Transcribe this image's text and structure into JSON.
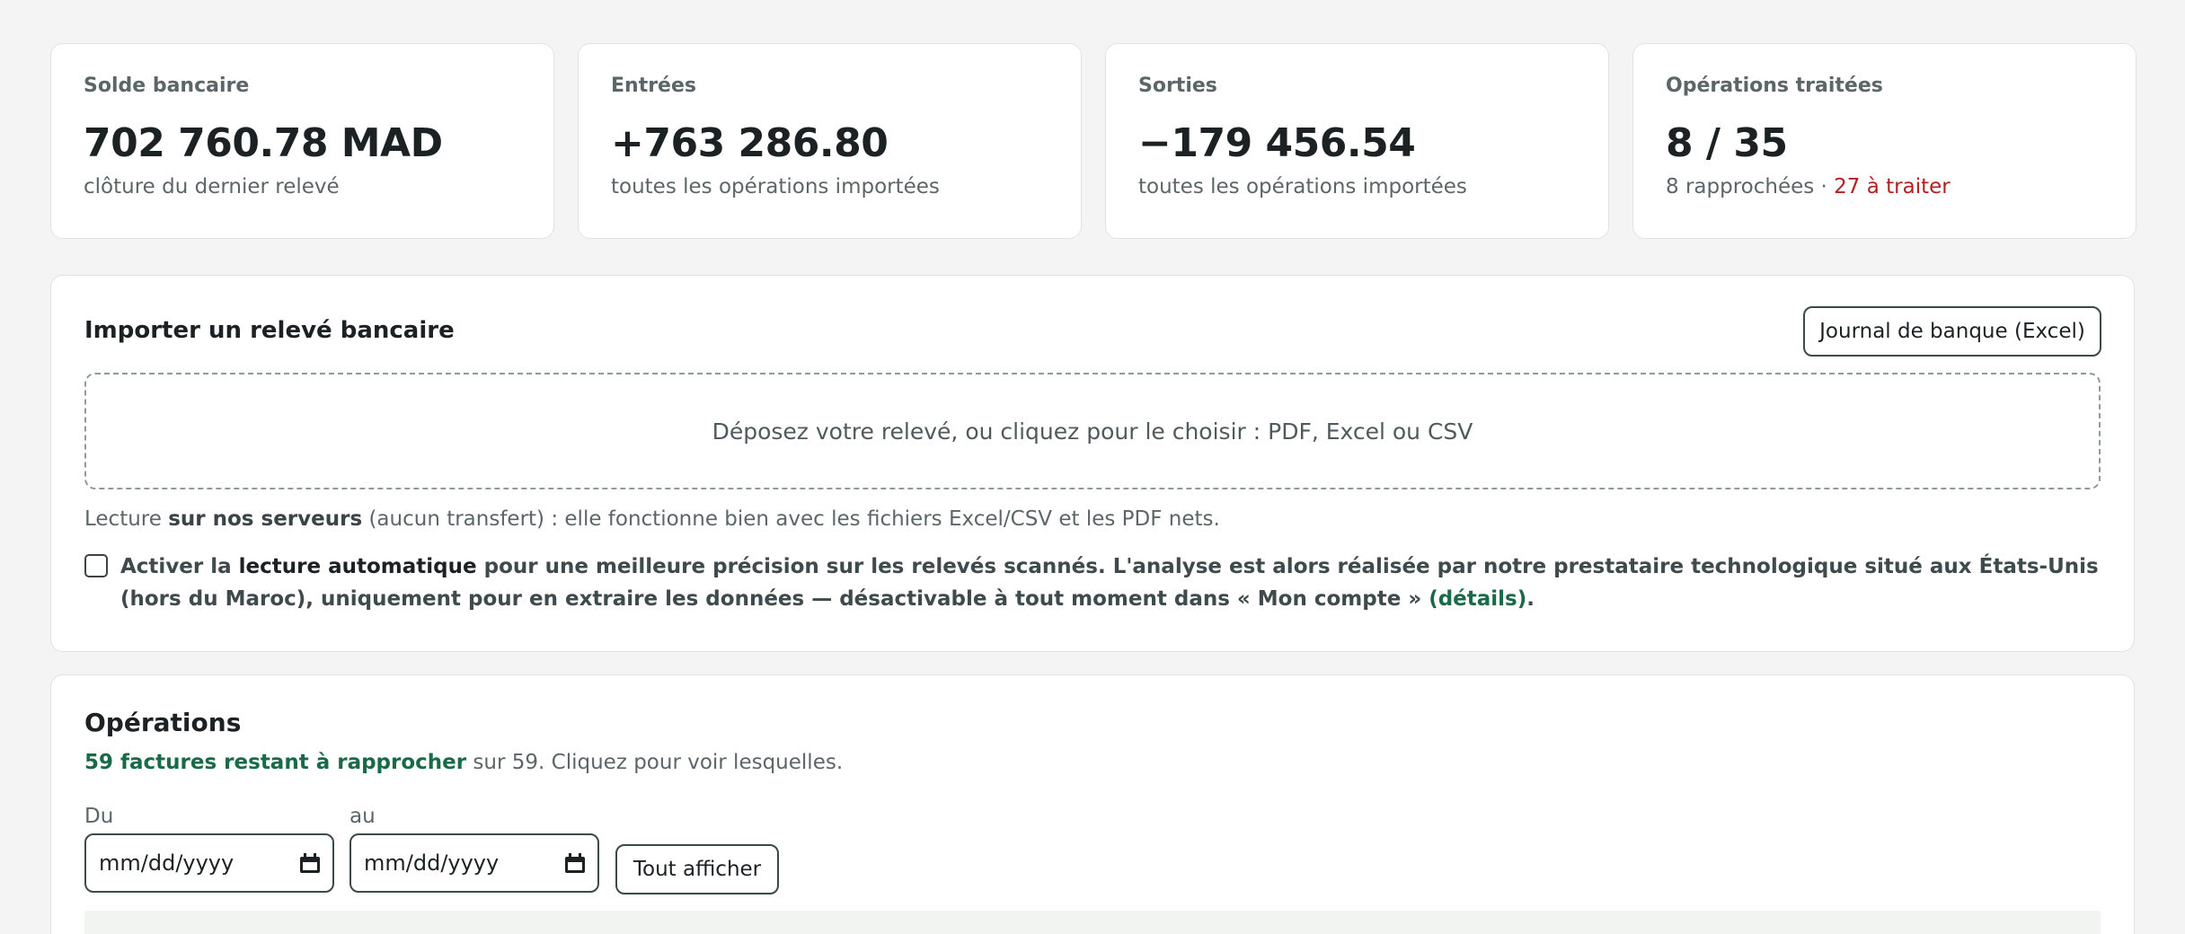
{
  "stats": [
    {
      "label": "Solde bancaire",
      "value": "702 760.78 MAD",
      "sub": "clôture du dernier relevé"
    },
    {
      "label": "Entrées",
      "value": "+763 286.80",
      "sub": "toutes les opérations importées"
    },
    {
      "label": "Sorties",
      "value": "−179 456.54",
      "sub": "toutes les opérations importées"
    },
    {
      "label": "Opérations traitées",
      "value": "8 / 35",
      "sub_main": "8 rapprochées · ",
      "sub_warn": "27 à traiter"
    }
  ],
  "import": {
    "title": "Importer un relevé bancaire",
    "journal_button": "Journal de banque (Excel)",
    "dropzone_text": "Déposez votre relevé, ou cliquez pour le choisir : PDF, Excel ou CSV",
    "note_prefix": "Lecture ",
    "note_bold": "sur nos serveurs",
    "note_suffix": " (aucun transfert) : elle fonctionne bien avec les fichiers Excel/CSV et les PDF nets.",
    "auto_prefix": "Activer la ",
    "auto_bold": "lecture automatique",
    "auto_text": " pour une meilleure précision sur les relevés scannés. L'analyse est alors réalisée par notre prestataire technologique situé aux États-Unis (hors du Maroc), uniquement pour en extraire les données — désactivable à tout moment dans « Mon compte » ",
    "auto_link": "(détails)",
    "auto_end": "."
  },
  "operations": {
    "title": "Opérations",
    "sub_link": "59 factures restant à rapprocher",
    "sub_text": " sur 59. Cliquez pour voir lesquelles.",
    "from_label": "Du",
    "to_label": "au",
    "from_value": "mm/dd/yyyy",
    "to_value": "mm/dd/yyyy",
    "show_all_button": "Tout afficher"
  }
}
